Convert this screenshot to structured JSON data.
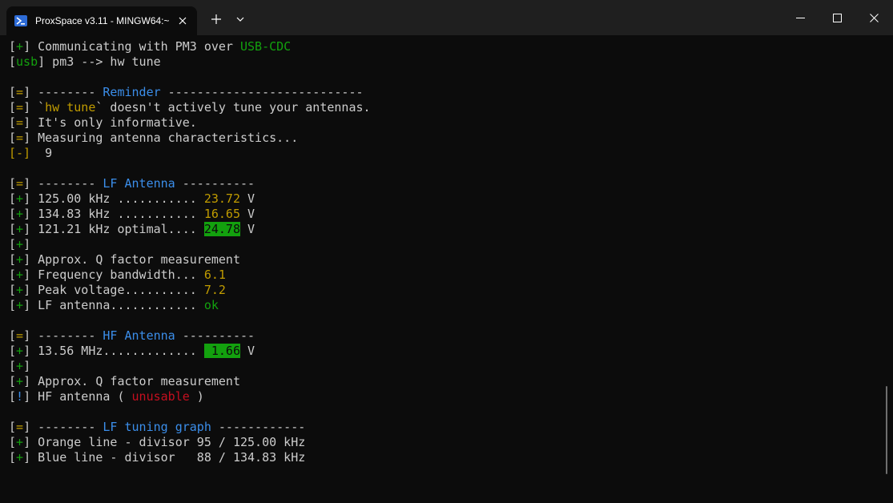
{
  "window": {
    "tab_title": "ProxSpace v3.11 - MINGW64:~",
    "icons": {
      "tab": "powershell-icon",
      "tab_close": "close-icon",
      "new_tab": "plus-icon",
      "dropdown": "chevron-down-icon",
      "minimize": "minimize-icon",
      "maximize": "maximize-icon",
      "close": "close-icon"
    }
  },
  "colors": {
    "background": "#0c0c0c",
    "text": "#cccccc",
    "yellow": "#c19c00",
    "green": "#13a10e",
    "blue": "#3b8eea",
    "red": "#c50f1f"
  },
  "terminal": {
    "lines": [
      [
        {
          "t": "[",
          "c": ""
        },
        {
          "t": "+",
          "c": "g"
        },
        {
          "t": "] Communicating with PM3 over ",
          "c": ""
        },
        {
          "t": "USB-CDC",
          "c": "g"
        }
      ],
      [
        {
          "t": "[",
          "c": ""
        },
        {
          "t": "usb",
          "c": "g"
        },
        {
          "t": "] pm3 --> hw tune",
          "c": ""
        }
      ],
      [],
      [
        {
          "t": "[",
          "c": ""
        },
        {
          "t": "=",
          "c": "y"
        },
        {
          "t": "] -------- ",
          "c": ""
        },
        {
          "t": "Reminder",
          "c": "b"
        },
        {
          "t": " ---------------------------",
          "c": ""
        }
      ],
      [
        {
          "t": "[",
          "c": ""
        },
        {
          "t": "=",
          "c": "y"
        },
        {
          "t": "] `",
          "c": ""
        },
        {
          "t": "hw tune",
          "c": "y"
        },
        {
          "t": "` doesn't actively tune your antennas.",
          "c": ""
        }
      ],
      [
        {
          "t": "[",
          "c": ""
        },
        {
          "t": "=",
          "c": "y"
        },
        {
          "t": "] It's only informative.",
          "c": ""
        }
      ],
      [
        {
          "t": "[",
          "c": ""
        },
        {
          "t": "=",
          "c": "y"
        },
        {
          "t": "] Measuring antenna characteristics...",
          "c": ""
        }
      ],
      [
        {
          "t": "[-]",
          "c": "y"
        },
        {
          "t": "  9",
          "c": ""
        }
      ],
      [],
      [
        {
          "t": "[",
          "c": ""
        },
        {
          "t": "=",
          "c": "y"
        },
        {
          "t": "] -------- ",
          "c": ""
        },
        {
          "t": "LF Antenna",
          "c": "b"
        },
        {
          "t": " ----------",
          "c": ""
        }
      ],
      [
        {
          "t": "[",
          "c": ""
        },
        {
          "t": "+",
          "c": "g"
        },
        {
          "t": "] 125.00 kHz ........... ",
          "c": ""
        },
        {
          "t": "23.72",
          "c": "y"
        },
        {
          "t": " V",
          "c": ""
        }
      ],
      [
        {
          "t": "[",
          "c": ""
        },
        {
          "t": "+",
          "c": "g"
        },
        {
          "t": "] 134.83 kHz ........... ",
          "c": ""
        },
        {
          "t": "16.65",
          "c": "y"
        },
        {
          "t": " V",
          "c": ""
        }
      ],
      [
        {
          "t": "[",
          "c": ""
        },
        {
          "t": "+",
          "c": "g"
        },
        {
          "t": "] 121.21 kHz optimal.... ",
          "c": ""
        },
        {
          "t": "24.78",
          "c": "gbg"
        },
        {
          "t": " V",
          "c": ""
        }
      ],
      [
        {
          "t": "[",
          "c": ""
        },
        {
          "t": "+",
          "c": "g"
        },
        {
          "t": "]",
          "c": ""
        }
      ],
      [
        {
          "t": "[",
          "c": ""
        },
        {
          "t": "+",
          "c": "g"
        },
        {
          "t": "] Approx. Q factor measurement",
          "c": ""
        }
      ],
      [
        {
          "t": "[",
          "c": ""
        },
        {
          "t": "+",
          "c": "g"
        },
        {
          "t": "] Frequency bandwidth... ",
          "c": ""
        },
        {
          "t": "6.1",
          "c": "y"
        }
      ],
      [
        {
          "t": "[",
          "c": ""
        },
        {
          "t": "+",
          "c": "g"
        },
        {
          "t": "] Peak voltage.......... ",
          "c": ""
        },
        {
          "t": "7.2",
          "c": "y"
        }
      ],
      [
        {
          "t": "[",
          "c": ""
        },
        {
          "t": "+",
          "c": "g"
        },
        {
          "t": "] LF antenna............ ",
          "c": ""
        },
        {
          "t": "ok",
          "c": "g"
        }
      ],
      [],
      [
        {
          "t": "[",
          "c": ""
        },
        {
          "t": "=",
          "c": "y"
        },
        {
          "t": "] -------- ",
          "c": ""
        },
        {
          "t": "HF Antenna",
          "c": "b"
        },
        {
          "t": " ----------",
          "c": ""
        }
      ],
      [
        {
          "t": "[",
          "c": ""
        },
        {
          "t": "+",
          "c": "g"
        },
        {
          "t": "] 13.56 MHz............. ",
          "c": ""
        },
        {
          "t": " 1.66",
          "c": "gbg"
        },
        {
          "t": " V",
          "c": ""
        }
      ],
      [
        {
          "t": "[",
          "c": ""
        },
        {
          "t": "+",
          "c": "g"
        },
        {
          "t": "]",
          "c": ""
        }
      ],
      [
        {
          "t": "[",
          "c": ""
        },
        {
          "t": "+",
          "c": "g"
        },
        {
          "t": "] Approx. Q factor measurement",
          "c": ""
        }
      ],
      [
        {
          "t": "[",
          "c": ""
        },
        {
          "t": "!",
          "c": "b"
        },
        {
          "t": "] HF antenna ( ",
          "c": ""
        },
        {
          "t": "unusable",
          "c": "r"
        },
        {
          "t": " )",
          "c": ""
        }
      ],
      [],
      [
        {
          "t": "[",
          "c": ""
        },
        {
          "t": "=",
          "c": "y"
        },
        {
          "t": "] -------- ",
          "c": ""
        },
        {
          "t": "LF tuning graph",
          "c": "b"
        },
        {
          "t": " ------------",
          "c": ""
        }
      ],
      [
        {
          "t": "[",
          "c": ""
        },
        {
          "t": "+",
          "c": "g"
        },
        {
          "t": "] Orange line - divisor 95 / 125.00 kHz",
          "c": ""
        }
      ],
      [
        {
          "t": "[",
          "c": ""
        },
        {
          "t": "+",
          "c": "g"
        },
        {
          "t": "] Blue line - divisor   88 / 134.83 kHz",
          "c": ""
        }
      ]
    ]
  }
}
